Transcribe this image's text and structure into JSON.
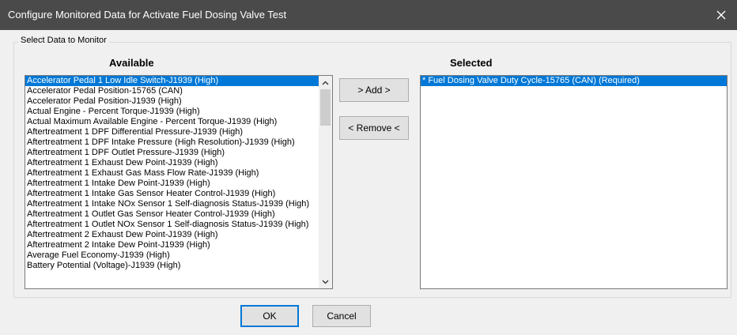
{
  "window": {
    "title": "Configure Monitored Data for Activate Fuel Dosing Valve Test",
    "close_icon": "close-icon"
  },
  "group": {
    "legend": "Select Data to Monitor"
  },
  "available": {
    "heading": "Available",
    "items": [
      "Accelerator Pedal 1 Low Idle Switch-J1939 (High)",
      "Accelerator Pedal Position-15765 (CAN)",
      "Accelerator Pedal Position-J1939 (High)",
      "Actual Engine - Percent Torque-J1939 (High)",
      "Actual Maximum Available Engine - Percent Torque-J1939 (High)",
      "Aftertreatment 1 DPF Differential Pressure-J1939 (High)",
      "Aftertreatment 1 DPF Intake Pressure (High Resolution)-J1939 (High)",
      "Aftertreatment 1 DPF Outlet Pressure-J1939 (High)",
      "Aftertreatment 1 Exhaust Dew Point-J1939 (High)",
      "Aftertreatment 1 Exhaust Gas Mass Flow Rate-J1939 (High)",
      "Aftertreatment 1 Intake Dew Point-J1939 (High)",
      "Aftertreatment 1 Intake Gas Sensor Heater Control-J1939 (High)",
      "Aftertreatment 1 Intake NOx Sensor 1 Self-diagnosis Status-J1939 (High)",
      "Aftertreatment 1 Outlet Gas Sensor Heater Control-J1939 (High)",
      "Aftertreatment 1 Outlet NOx Sensor 1 Self-diagnosis Status-J1939 (High)",
      "Aftertreatment 2 Exhaust Dew Point-J1939 (High)",
      "Aftertreatment 2 Intake Dew Point-J1939 (High)",
      "Average Fuel Economy-J1939 (High)",
      "Battery Potential (Voltage)-J1939 (High)"
    ],
    "highlighted_index": 0,
    "scroll_up_icon": "chevron-up-icon",
    "scroll_down_icon": "chevron-down-icon"
  },
  "selected": {
    "heading": "Selected",
    "items": [
      "* Fuel Dosing Valve Duty Cycle-15765 (CAN) (Required)"
    ]
  },
  "buttons": {
    "add": "> Add >",
    "remove": "< Remove <",
    "ok": "OK",
    "cancel": "Cancel"
  },
  "colors": {
    "titlebar": "#4a4a4a",
    "selection": "#0078d7",
    "default_button_border": "#0078d7"
  }
}
